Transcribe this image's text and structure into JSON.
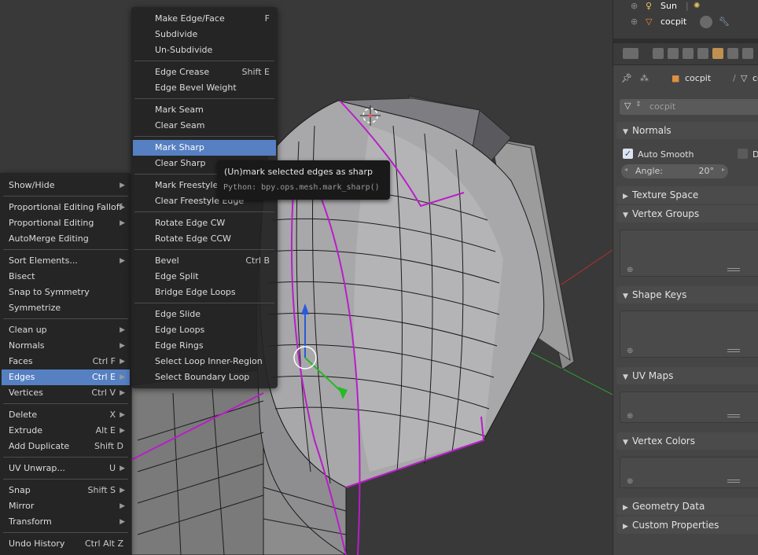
{
  "left_menu": {
    "items": [
      {
        "label": "Show/Hide",
        "shortcut": "",
        "submenu": true
      },
      {
        "label": "Proportional Editing Falloff",
        "shortcut": "",
        "submenu": true
      },
      {
        "label": "Proportional Editing",
        "shortcut": "",
        "submenu": true
      },
      {
        "label": "AutoMerge Editing",
        "shortcut": "",
        "submenu": false
      },
      {
        "label": "Sort Elements...",
        "shortcut": "",
        "submenu": true
      },
      {
        "label": "Bisect",
        "shortcut": "",
        "submenu": false
      },
      {
        "label": "Snap to Symmetry",
        "shortcut": "",
        "submenu": false
      },
      {
        "label": "Symmetrize",
        "shortcut": "",
        "submenu": false
      },
      {
        "label": "Clean up",
        "shortcut": "",
        "submenu": true
      },
      {
        "label": "Normals",
        "shortcut": "",
        "submenu": true
      },
      {
        "label": "Faces",
        "shortcut": "Ctrl F",
        "submenu": true
      },
      {
        "label": "Edges",
        "shortcut": "Ctrl E",
        "submenu": true,
        "selected": true
      },
      {
        "label": "Vertices",
        "shortcut": "Ctrl V",
        "submenu": true
      },
      {
        "label": "Delete",
        "shortcut": "X",
        "submenu": true
      },
      {
        "label": "Extrude",
        "shortcut": "Alt E",
        "submenu": true
      },
      {
        "label": "Add Duplicate",
        "shortcut": "Shift D",
        "submenu": false
      },
      {
        "label": "UV Unwrap...",
        "shortcut": "U",
        "submenu": true
      },
      {
        "label": "Snap",
        "shortcut": "Shift S",
        "submenu": true
      },
      {
        "label": "Mirror",
        "shortcut": "",
        "submenu": true
      },
      {
        "label": "Transform",
        "shortcut": "",
        "submenu": true
      },
      {
        "label": "Undo History",
        "shortcut": "Ctrl Alt Z",
        "submenu": false
      }
    ]
  },
  "edges_menu": {
    "items": [
      {
        "label": "Make Edge/Face",
        "shortcut": "F"
      },
      {
        "label": "Subdivide",
        "shortcut": ""
      },
      {
        "label": "Un-Subdivide",
        "shortcut": ""
      },
      {
        "label": "Edge Crease",
        "shortcut": "Shift E"
      },
      {
        "label": "Edge Bevel Weight",
        "shortcut": ""
      },
      {
        "label": "Mark Seam",
        "shortcut": ""
      },
      {
        "label": "Clear Seam",
        "shortcut": ""
      },
      {
        "label": "Mark Sharp",
        "shortcut": "",
        "selected": true
      },
      {
        "label": "Clear Sharp",
        "shortcut": ""
      },
      {
        "label": "Mark Freestyle Edge",
        "shortcut": ""
      },
      {
        "label": "Clear Freestyle Edge",
        "shortcut": ""
      },
      {
        "label": "Rotate Edge CW",
        "shortcut": ""
      },
      {
        "label": "Rotate Edge CCW",
        "shortcut": ""
      },
      {
        "label": "Bevel",
        "shortcut": "Ctrl B"
      },
      {
        "label": "Edge Split",
        "shortcut": ""
      },
      {
        "label": "Bridge Edge Loops",
        "shortcut": ""
      },
      {
        "label": "Edge Slide",
        "shortcut": ""
      },
      {
        "label": "Edge Loops",
        "shortcut": ""
      },
      {
        "label": "Edge Rings",
        "shortcut": ""
      },
      {
        "label": "Select Loop Inner-Region",
        "shortcut": ""
      },
      {
        "label": "Select Boundary Loop",
        "shortcut": ""
      }
    ]
  },
  "tooltip": {
    "description": "(Un)mark selected edges as sharp",
    "python": "Python: bpy.ops.mesh.mark_sharp()"
  },
  "outliner": {
    "rows": [
      {
        "label": "Sun",
        "icon": "lamp-icon"
      },
      {
        "label": "cocpit",
        "icon": "mesh-icon"
      }
    ]
  },
  "properties": {
    "breadcrumb_object": "cocpit",
    "breadcrumb_data": "cocpit",
    "datablock_name": "cocpit",
    "panels": {
      "normals": "Normals",
      "auto_smooth_label": "Auto Smooth",
      "auto_smooth_checked": true,
      "double_sided_label": "D",
      "angle_label": "Angle:",
      "angle_value": "20°",
      "texture_space": "Texture Space",
      "vertex_groups": "Vertex Groups",
      "shape_keys": "Shape Keys",
      "uv_maps": "UV Maps",
      "vertex_colors": "Vertex Colors",
      "geometry_data": "Geometry Data",
      "custom_properties": "Custom Properties"
    }
  },
  "colors": {
    "selection": "#5680c2",
    "sharp_edge": "#b81ec8",
    "menu_bg": "#242424"
  }
}
